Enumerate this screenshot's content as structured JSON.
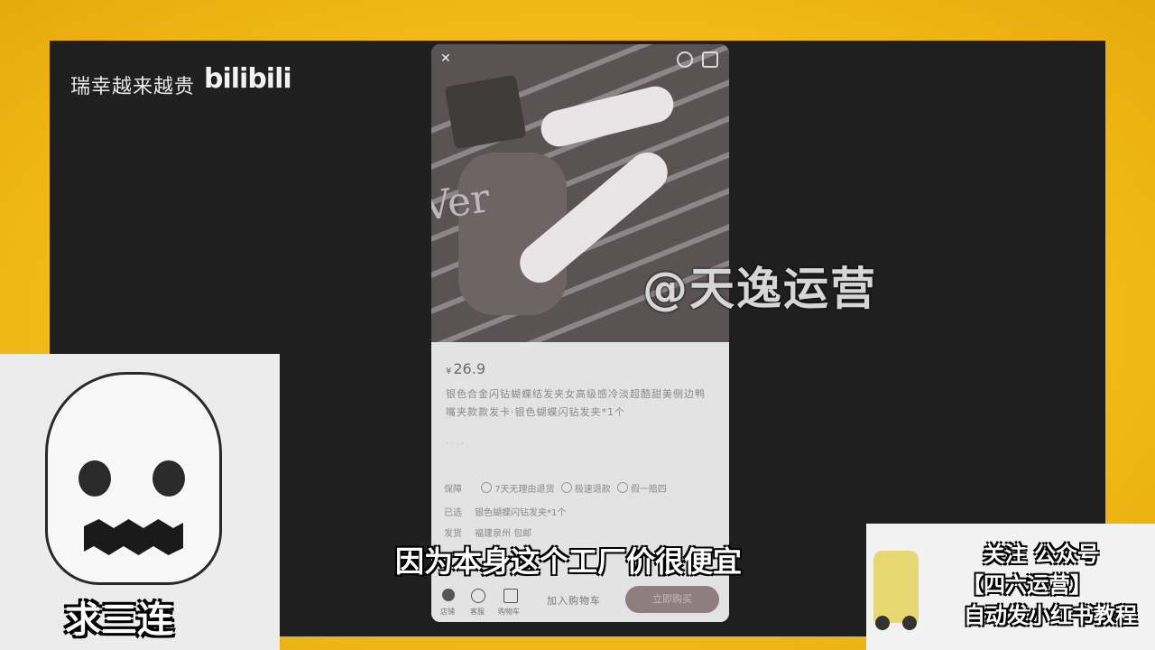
{
  "header": {
    "channel_title": "瑞幸越来越贵",
    "platform_logo": "bilibili"
  },
  "product": {
    "currency": "¥",
    "price": "26.9",
    "description": "银色合金闪钻蝴蝶结发夹女高级感冷淡超酷甜美侧边鸭嘴夹款款发卡·银色蝴蝶闪钻发夹*1个",
    "extra_info": "· · · ·",
    "guarantee_label": "保障",
    "guarantees": [
      "7天无理由退货",
      "极速退款",
      "假一赔四"
    ],
    "selected_label": "已选",
    "selected_value": "银色蝴蝶闪钻发夹*1个",
    "shipping_label": "发货",
    "shipping_value": "福建泉州   包邮",
    "image_text": "Ver"
  },
  "bottom_bar": {
    "shop_label": "店铺",
    "service_label": "客服",
    "cart_label": "购物车",
    "cart_badge": "1",
    "add_to_cart": "加入购物车",
    "buy_now": "立即购买"
  },
  "watermark": "@天逸运营",
  "subtitle": "因为本身这个工厂价很便宜",
  "left_caption": "求三连",
  "promo": {
    "line1": "关注 公众号",
    "line2": "【四六运营】",
    "line3": "自动发小红书教程"
  }
}
